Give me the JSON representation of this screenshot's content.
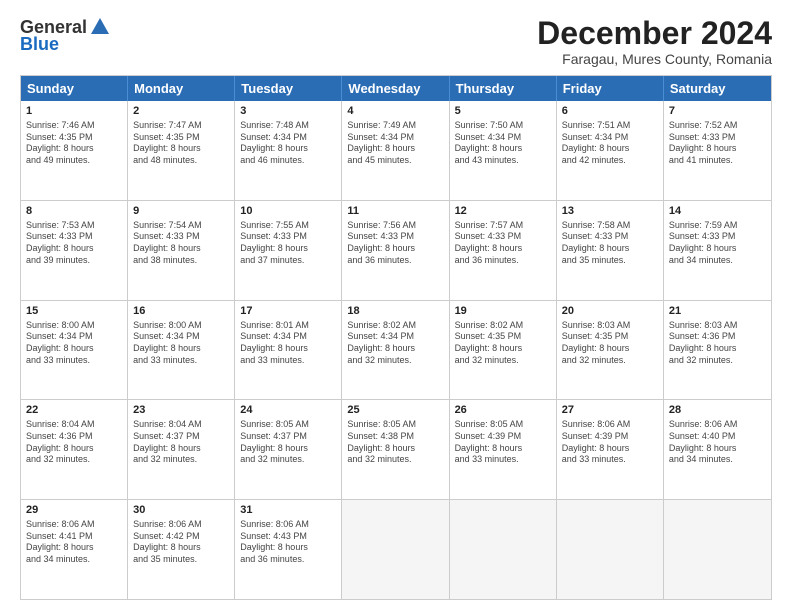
{
  "header": {
    "logo_general": "General",
    "logo_blue": "Blue",
    "month_title": "December 2024",
    "location": "Faragau, Mures County, Romania"
  },
  "days_of_week": [
    "Sunday",
    "Monday",
    "Tuesday",
    "Wednesday",
    "Thursday",
    "Friday",
    "Saturday"
  ],
  "weeks": [
    [
      {
        "day": "1",
        "info": "Sunrise: 7:46 AM\nSunset: 4:35 PM\nDaylight: 8 hours\nand 49 minutes."
      },
      {
        "day": "2",
        "info": "Sunrise: 7:47 AM\nSunset: 4:35 PM\nDaylight: 8 hours\nand 48 minutes."
      },
      {
        "day": "3",
        "info": "Sunrise: 7:48 AM\nSunset: 4:34 PM\nDaylight: 8 hours\nand 46 minutes."
      },
      {
        "day": "4",
        "info": "Sunrise: 7:49 AM\nSunset: 4:34 PM\nDaylight: 8 hours\nand 45 minutes."
      },
      {
        "day": "5",
        "info": "Sunrise: 7:50 AM\nSunset: 4:34 PM\nDaylight: 8 hours\nand 43 minutes."
      },
      {
        "day": "6",
        "info": "Sunrise: 7:51 AM\nSunset: 4:34 PM\nDaylight: 8 hours\nand 42 minutes."
      },
      {
        "day": "7",
        "info": "Sunrise: 7:52 AM\nSunset: 4:33 PM\nDaylight: 8 hours\nand 41 minutes."
      }
    ],
    [
      {
        "day": "8",
        "info": "Sunrise: 7:53 AM\nSunset: 4:33 PM\nDaylight: 8 hours\nand 39 minutes."
      },
      {
        "day": "9",
        "info": "Sunrise: 7:54 AM\nSunset: 4:33 PM\nDaylight: 8 hours\nand 38 minutes."
      },
      {
        "day": "10",
        "info": "Sunrise: 7:55 AM\nSunset: 4:33 PM\nDaylight: 8 hours\nand 37 minutes."
      },
      {
        "day": "11",
        "info": "Sunrise: 7:56 AM\nSunset: 4:33 PM\nDaylight: 8 hours\nand 36 minutes."
      },
      {
        "day": "12",
        "info": "Sunrise: 7:57 AM\nSunset: 4:33 PM\nDaylight: 8 hours\nand 36 minutes."
      },
      {
        "day": "13",
        "info": "Sunrise: 7:58 AM\nSunset: 4:33 PM\nDaylight: 8 hours\nand 35 minutes."
      },
      {
        "day": "14",
        "info": "Sunrise: 7:59 AM\nSunset: 4:33 PM\nDaylight: 8 hours\nand 34 minutes."
      }
    ],
    [
      {
        "day": "15",
        "info": "Sunrise: 8:00 AM\nSunset: 4:34 PM\nDaylight: 8 hours\nand 33 minutes."
      },
      {
        "day": "16",
        "info": "Sunrise: 8:00 AM\nSunset: 4:34 PM\nDaylight: 8 hours\nand 33 minutes."
      },
      {
        "day": "17",
        "info": "Sunrise: 8:01 AM\nSunset: 4:34 PM\nDaylight: 8 hours\nand 33 minutes."
      },
      {
        "day": "18",
        "info": "Sunrise: 8:02 AM\nSunset: 4:34 PM\nDaylight: 8 hours\nand 32 minutes."
      },
      {
        "day": "19",
        "info": "Sunrise: 8:02 AM\nSunset: 4:35 PM\nDaylight: 8 hours\nand 32 minutes."
      },
      {
        "day": "20",
        "info": "Sunrise: 8:03 AM\nSunset: 4:35 PM\nDaylight: 8 hours\nand 32 minutes."
      },
      {
        "day": "21",
        "info": "Sunrise: 8:03 AM\nSunset: 4:36 PM\nDaylight: 8 hours\nand 32 minutes."
      }
    ],
    [
      {
        "day": "22",
        "info": "Sunrise: 8:04 AM\nSunset: 4:36 PM\nDaylight: 8 hours\nand 32 minutes."
      },
      {
        "day": "23",
        "info": "Sunrise: 8:04 AM\nSunset: 4:37 PM\nDaylight: 8 hours\nand 32 minutes."
      },
      {
        "day": "24",
        "info": "Sunrise: 8:05 AM\nSunset: 4:37 PM\nDaylight: 8 hours\nand 32 minutes."
      },
      {
        "day": "25",
        "info": "Sunrise: 8:05 AM\nSunset: 4:38 PM\nDaylight: 8 hours\nand 32 minutes."
      },
      {
        "day": "26",
        "info": "Sunrise: 8:05 AM\nSunset: 4:39 PM\nDaylight: 8 hours\nand 33 minutes."
      },
      {
        "day": "27",
        "info": "Sunrise: 8:06 AM\nSunset: 4:39 PM\nDaylight: 8 hours\nand 33 minutes."
      },
      {
        "day": "28",
        "info": "Sunrise: 8:06 AM\nSunset: 4:40 PM\nDaylight: 8 hours\nand 34 minutes."
      }
    ],
    [
      {
        "day": "29",
        "info": "Sunrise: 8:06 AM\nSunset: 4:41 PM\nDaylight: 8 hours\nand 34 minutes."
      },
      {
        "day": "30",
        "info": "Sunrise: 8:06 AM\nSunset: 4:42 PM\nDaylight: 8 hours\nand 35 minutes."
      },
      {
        "day": "31",
        "info": "Sunrise: 8:06 AM\nSunset: 4:43 PM\nDaylight: 8 hours\nand 36 minutes."
      },
      {
        "day": "",
        "info": ""
      },
      {
        "day": "",
        "info": ""
      },
      {
        "day": "",
        "info": ""
      },
      {
        "day": "",
        "info": ""
      }
    ]
  ]
}
